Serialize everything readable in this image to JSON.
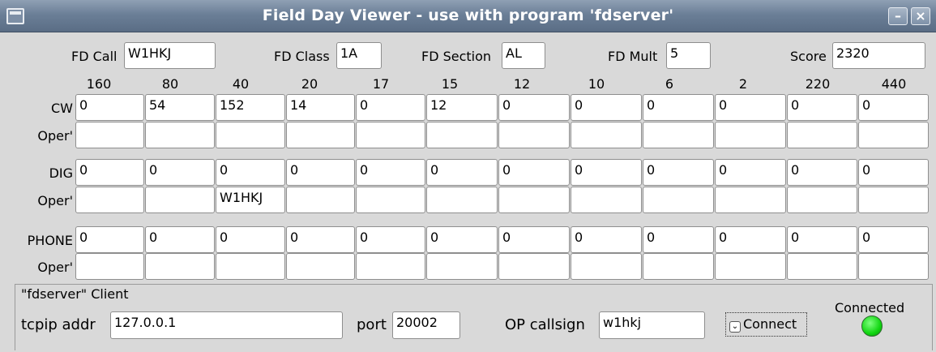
{
  "window": {
    "title": "Field Day Viewer - use with program 'fdserver'",
    "minimize_glyph": "–",
    "close_glyph": "×"
  },
  "header": {
    "fd_call": {
      "label": "FD Call",
      "value": "W1HKJ"
    },
    "fd_class": {
      "label": "FD Class",
      "value": "1A"
    },
    "fd_section": {
      "label": "FD Section",
      "value": "AL"
    },
    "fd_mult": {
      "label": "FD Mult",
      "value": "5"
    },
    "score": {
      "label": "Score",
      "value": "2320"
    }
  },
  "bands": [
    "160",
    "80",
    "40",
    "20",
    "17",
    "15",
    "12",
    "10",
    "6",
    "2",
    "220",
    "440"
  ],
  "modes": [
    {
      "label": "CW",
      "oper_label": "Oper'",
      "counts": [
        "0",
        "54",
        "152",
        "14",
        "0",
        "12",
        "0",
        "0",
        "0",
        "0",
        "0",
        "0"
      ],
      "opers": [
        "",
        "",
        "",
        "",
        "",
        "",
        "",
        "",
        "",
        "",
        "",
        ""
      ]
    },
    {
      "label": "DIG",
      "oper_label": "Oper'",
      "counts": [
        "0",
        "0",
        "0",
        "0",
        "0",
        "0",
        "0",
        "0",
        "0",
        "0",
        "0",
        "0"
      ],
      "opers": [
        "",
        "",
        "W1HKJ",
        "",
        "",
        "",
        "",
        "",
        "",
        "",
        "",
        ""
      ]
    },
    {
      "label": "PHONE",
      "oper_label": "Oper'",
      "counts": [
        "0",
        "0",
        "0",
        "0",
        "0",
        "0",
        "0",
        "0",
        "0",
        "0",
        "0",
        "0"
      ],
      "opers": [
        "",
        "",
        "",
        "",
        "",
        "",
        "",
        "",
        "",
        "",
        "",
        ""
      ]
    }
  ],
  "client": {
    "title": "\"fdserver\" Client",
    "tcpip_label": "tcpip addr",
    "tcpip_value": "127.0.0.1",
    "port_label": "port",
    "port_value": "20002",
    "callsign_label": "OP callsign",
    "callsign_value": "w1hkj",
    "connect_label": "Connect",
    "status_label": "Connected",
    "status_color": "#11d611"
  }
}
